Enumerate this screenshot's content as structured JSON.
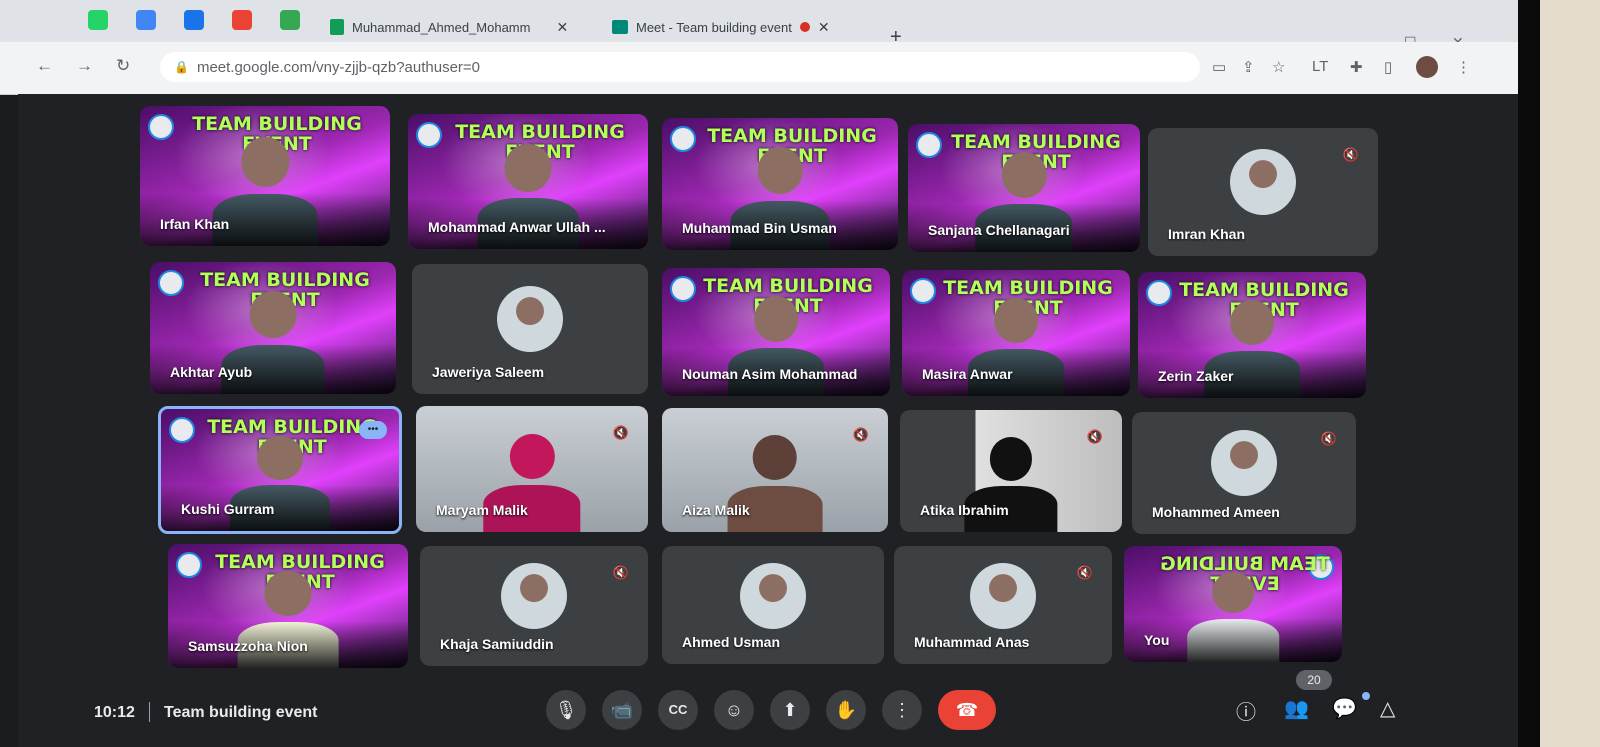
{
  "browser": {
    "tabs": [
      {
        "label": "Muhammad_Ahmed_Mohamm",
        "close": "✕",
        "fav_color": "#0f9d58"
      },
      {
        "label": "Meet - Team building event",
        "close": "✕",
        "recording": true
      }
    ],
    "new_tab": "+",
    "url": "meet.google.com/vny-zjjb-qzb?authuser=0",
    "back": "←",
    "forward": "→",
    "reload": "↻",
    "window_min": "—",
    "window_max": "☐",
    "window_close": "✕"
  },
  "participants": [
    {
      "name": "Irfan Khan",
      "type": "banner"
    },
    {
      "name": "Mohammad Anwar Ullah ...",
      "type": "banner"
    },
    {
      "name": "Muhammad Bin Usman",
      "type": "banner"
    },
    {
      "name": "Sanjana Chellanagari",
      "type": "banner"
    },
    {
      "name": "Imran Khan",
      "type": "avatar",
      "muted": true
    },
    {
      "name": "Akhtar Ayub",
      "type": "banner"
    },
    {
      "name": "Jaweriya Saleem",
      "type": "avatar"
    },
    {
      "name": "Nouman Asim Mohammad",
      "type": "banner"
    },
    {
      "name": "Masira Anwar",
      "type": "banner"
    },
    {
      "name": "Zerin Zaker",
      "type": "banner"
    },
    {
      "name": "Kushi Gurram",
      "type": "banner",
      "active": true
    },
    {
      "name": "Maryam Malik",
      "type": "cam",
      "muted": true
    },
    {
      "name": "Aiza Malik",
      "type": "cam",
      "muted": true
    },
    {
      "name": "Atika Ibrahim",
      "type": "cam",
      "muted": true
    },
    {
      "name": "Mohammed Ameen",
      "type": "avatar",
      "muted": true
    },
    {
      "name": "Samsuzzoha Nion",
      "type": "banner"
    },
    {
      "name": "Khaja Samiuddin",
      "type": "avatar",
      "muted": true
    },
    {
      "name": "Ahmed Usman",
      "type": "avatar"
    },
    {
      "name": "Muhammad Anas",
      "type": "avatar",
      "muted": true
    },
    {
      "name": "You",
      "type": "banner"
    }
  ],
  "banner": {
    "title_line1": "TEAM BUILDING",
    "title_line2": "EVENT"
  },
  "bottom": {
    "time": "10:12",
    "meeting_title": "Team building event",
    "participant_count": "20"
  },
  "icons": {
    "mic": "🎙",
    "camera": "📹",
    "captions": "CC",
    "emoji": "☺",
    "present": "⬆",
    "hand": "✋",
    "more": "⋮",
    "hangup": "☎",
    "info": "ⓘ",
    "people": "👥",
    "chat": "💬",
    "activities": "△",
    "mute": "🔇"
  }
}
